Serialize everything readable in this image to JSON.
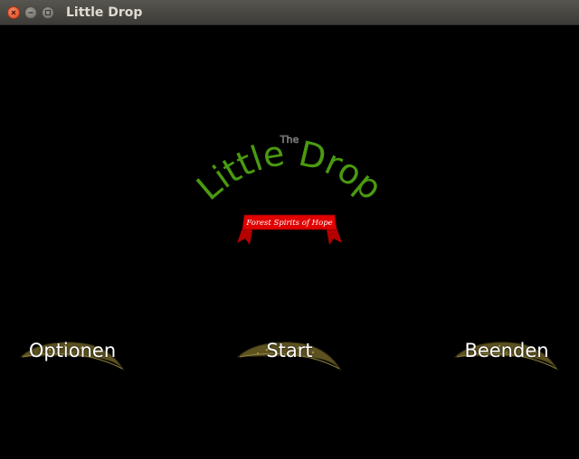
{
  "window": {
    "title": "Little Drop"
  },
  "logo": {
    "prefix": "The",
    "title": "Little Drop",
    "ribbon": "Forest Spirits of Hope",
    "colors": {
      "title": "#4a9a10",
      "ribbon": "#e00000"
    }
  },
  "menu": {
    "options_label": "Optionen",
    "start_label": "Start",
    "quit_label": "Beenden"
  }
}
